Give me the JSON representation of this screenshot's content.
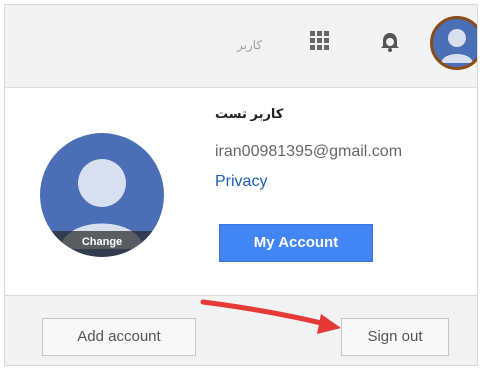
{
  "topbar": {
    "user_name": "کاربر",
    "icons": {
      "apps": "apps-grid-icon",
      "notifications": "notifications-bell-icon",
      "avatar": "account-avatar-icon"
    }
  },
  "account_panel": {
    "display_name": "کاربر تست",
    "email": "iran00981395@gmail.com",
    "privacy_link": "Privacy",
    "my_account_button": "My Account",
    "avatar_change_label": "Change"
  },
  "footer": {
    "add_account_button": "Add account",
    "sign_out_button": "Sign out"
  },
  "colors": {
    "primary_button": "#4285f4",
    "link": "#1a5fb4",
    "avatar_bg": "#4a6fb7",
    "highlight_ring": "#8a4b16",
    "arrow": "#e53935"
  }
}
